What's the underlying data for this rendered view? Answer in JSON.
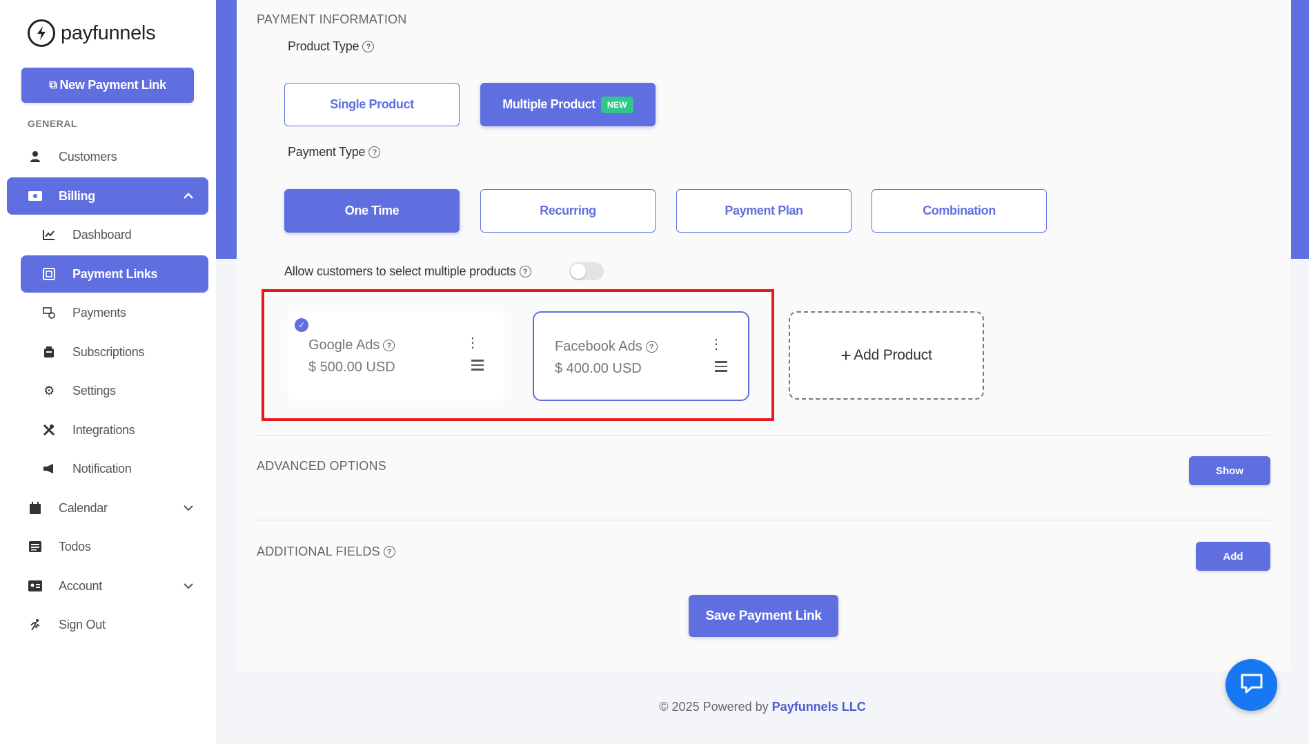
{
  "brand": {
    "name": "payfunnels"
  },
  "sidebar": {
    "new_link_label": "New Payment Link",
    "section_general": "GENERAL",
    "items": {
      "customers": "Customers",
      "billing": "Billing",
      "dashboard": "Dashboard",
      "payment_links": "Payment Links",
      "payments": "Payments",
      "subscriptions": "Subscriptions",
      "settings": "Settings",
      "integrations": "Integrations",
      "notification": "Notification",
      "calendar": "Calendar",
      "todos": "Todos",
      "account": "Account",
      "sign_out": "Sign Out"
    }
  },
  "payment_info": {
    "section_title": "PAYMENT INFORMATION",
    "product_type_label": "Product Type",
    "product_types": {
      "single": "Single Product",
      "multiple": "Multiple Product",
      "new_badge": "NEW"
    },
    "payment_type_label": "Payment Type",
    "payment_types": {
      "one_time": "One Time",
      "recurring": "Recurring",
      "payment_plan": "Payment Plan",
      "combination": "Combination"
    },
    "allow_multiple_label": "Allow customers to select multiple products",
    "allow_multiple_enabled": false
  },
  "products": [
    {
      "name": "Google Ads",
      "price": "$ 500.00 USD",
      "checked": true
    },
    {
      "name": "Facebook Ads",
      "price": "$ 400.00 USD",
      "checked": false
    }
  ],
  "add_product_label": "Add Product",
  "advanced": {
    "title": "ADVANCED OPTIONS",
    "button": "Show"
  },
  "additional": {
    "title": "ADDITIONAL FIELDS",
    "button": "Add"
  },
  "save_label": "Save Payment Link",
  "footer": {
    "prefix": "© 2025 Powered by",
    "company": "Payfunnels LLC"
  },
  "colors": {
    "accent": "#5f6fe0",
    "new_badge": "#2ec98a",
    "highlight": "#e41b1b",
    "chat": "#1877f2"
  }
}
